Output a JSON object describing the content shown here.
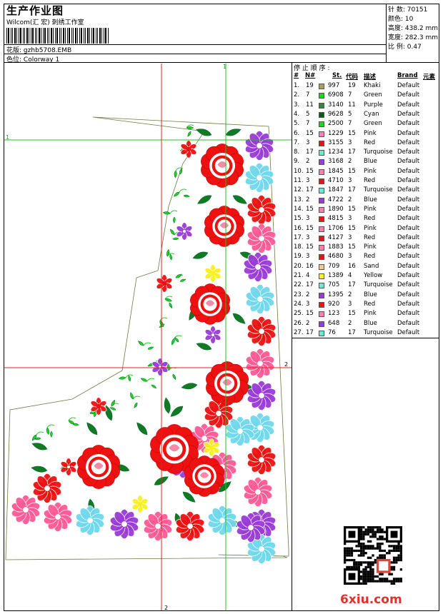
{
  "header": {
    "title": "生产作业图",
    "company": "Wilcom(汇 宏) 刺绣工作室",
    "design_label": "花版:",
    "design_file": "gzhb5708.EMB",
    "colorway_label": "色位:",
    "colorway": "Colorway 1"
  },
  "info": {
    "stitches": "针 数: 70151",
    "colors": "颜色: 10",
    "height": "高度: 438.2 mm",
    "width": "宽度: 282.3 mm",
    "scale": "比 例: 0.47"
  },
  "table": {
    "title": "停 止 顺 序 :",
    "headers": {
      "num": "#",
      "no": "N#",
      "st": "St.",
      "code": "代码",
      "desc": "描述",
      "brand": "Brand",
      "elem": "元素"
    },
    "rows": [
      {
        "idx": "1.",
        "n": "19",
        "st": "997",
        "code": "19",
        "desc": "Khaki",
        "brand": "Default",
        "color": "#a8a060"
      },
      {
        "idx": "2.",
        "n": "7",
        "st": "6908",
        "code": "7",
        "desc": "Green",
        "brand": "Default",
        "color": "#19d819"
      },
      {
        "idx": "3.",
        "n": "11",
        "st": "3140",
        "code": "11",
        "desc": "Purple",
        "brand": "Default",
        "color": "#2e8a3a"
      },
      {
        "idx": "4.",
        "n": "5",
        "st": "9628",
        "code": "5",
        "desc": "Cyan",
        "brand": "Default",
        "color": "#0d5a1c"
      },
      {
        "idx": "5.",
        "n": "7",
        "st": "2500",
        "code": "7",
        "desc": "Green",
        "brand": "Default",
        "color": "#19d819"
      },
      {
        "idx": "6.",
        "n": "15",
        "st": "1229",
        "code": "15",
        "desc": "Pink",
        "brand": "Default",
        "color": "#ff7fb0"
      },
      {
        "idx": "7.",
        "n": "3",
        "st": "3155",
        "code": "3",
        "desc": "Red",
        "brand": "Default",
        "color": "#ee1111"
      },
      {
        "idx": "8.",
        "n": "17",
        "st": "1234",
        "code": "17",
        "desc": "Turquoise",
        "brand": "Default",
        "color": "#70e8d0"
      },
      {
        "idx": "9.",
        "n": "2",
        "st": "3168",
        "code": "2",
        "desc": "Blue",
        "brand": "Default",
        "color": "#9a3ad8"
      },
      {
        "idx": "10.",
        "n": "15",
        "st": "1845",
        "code": "15",
        "desc": "Pink",
        "brand": "Default",
        "color": "#ff7fb0"
      },
      {
        "idx": "11.",
        "n": "3",
        "st": "4710",
        "code": "3",
        "desc": "Red",
        "brand": "Default",
        "color": "#ee1111"
      },
      {
        "idx": "12.",
        "n": "17",
        "st": "1847",
        "code": "17",
        "desc": "Turquoise",
        "brand": "Default",
        "color": "#70e8d0"
      },
      {
        "idx": "13.",
        "n": "2",
        "st": "4722",
        "code": "2",
        "desc": "Blue",
        "brand": "Default",
        "color": "#9a3ad8"
      },
      {
        "idx": "14.",
        "n": "15",
        "st": "1890",
        "code": "15",
        "desc": "Pink",
        "brand": "Default",
        "color": "#ff7fb0"
      },
      {
        "idx": "15.",
        "n": "3",
        "st": "4815",
        "code": "3",
        "desc": "Red",
        "brand": "Default",
        "color": "#ee1111"
      },
      {
        "idx": "16.",
        "n": "15",
        "st": "1706",
        "code": "15",
        "desc": "Pink",
        "brand": "Default",
        "color": "#ff7fb0"
      },
      {
        "idx": "17.",
        "n": "3",
        "st": "4127",
        "code": "3",
        "desc": "Red",
        "brand": "Default",
        "color": "#ee1111"
      },
      {
        "idx": "18.",
        "n": "15",
        "st": "1883",
        "code": "15",
        "desc": "Pink",
        "brand": "Default",
        "color": "#ff7fb0"
      },
      {
        "idx": "19.",
        "n": "3",
        "st": "4680",
        "code": "3",
        "desc": "Red",
        "brand": "Default",
        "color": "#ee1111"
      },
      {
        "idx": "20.",
        "n": "16",
        "st": "709",
        "code": "16",
        "desc": "Sand",
        "brand": "Default",
        "color": "#f4c890"
      },
      {
        "idx": "21.",
        "n": "4",
        "st": "1389",
        "code": "4",
        "desc": "Yellow",
        "brand": "Default",
        "color": "#f8f020"
      },
      {
        "idx": "22.",
        "n": "17",
        "st": "705",
        "code": "17",
        "desc": "Turquoise",
        "brand": "Default",
        "color": "#70e8d0"
      },
      {
        "idx": "23.",
        "n": "2",
        "st": "1395",
        "code": "2",
        "desc": "Blue",
        "brand": "Default",
        "color": "#9a3ad8"
      },
      {
        "idx": "24.",
        "n": "3",
        "st": "920",
        "code": "3",
        "desc": "Red",
        "brand": "Default",
        "color": "#ee1111"
      },
      {
        "idx": "25.",
        "n": "15",
        "st": "123",
        "code": "15",
        "desc": "Pink",
        "brand": "Default",
        "color": "#ff7fb0"
      },
      {
        "idx": "26.",
        "n": "2",
        "st": "648",
        "code": "2",
        "desc": "Blue",
        "brand": "Default",
        "color": "#9a3ad8"
      },
      {
        "idx": "27.",
        "n": "17",
        "st": "76",
        "code": "17",
        "desc": "Turquoise",
        "brand": "Default",
        "color": "#70e8d0"
      }
    ]
  },
  "guides": {
    "v1": "1",
    "h1": "1",
    "v2": "2",
    "h2": "2"
  },
  "watermark": "6xiu.com",
  "colors": {
    "red": "#ee1111",
    "green": "#19d819",
    "darkgreen": "#117a22",
    "pink": "#ff5a96",
    "purple": "#9a3ad8",
    "cyan": "#70d8ec",
    "yellow": "#f8f020",
    "guide_red": "#e02020",
    "guide_green": "#20c020"
  }
}
